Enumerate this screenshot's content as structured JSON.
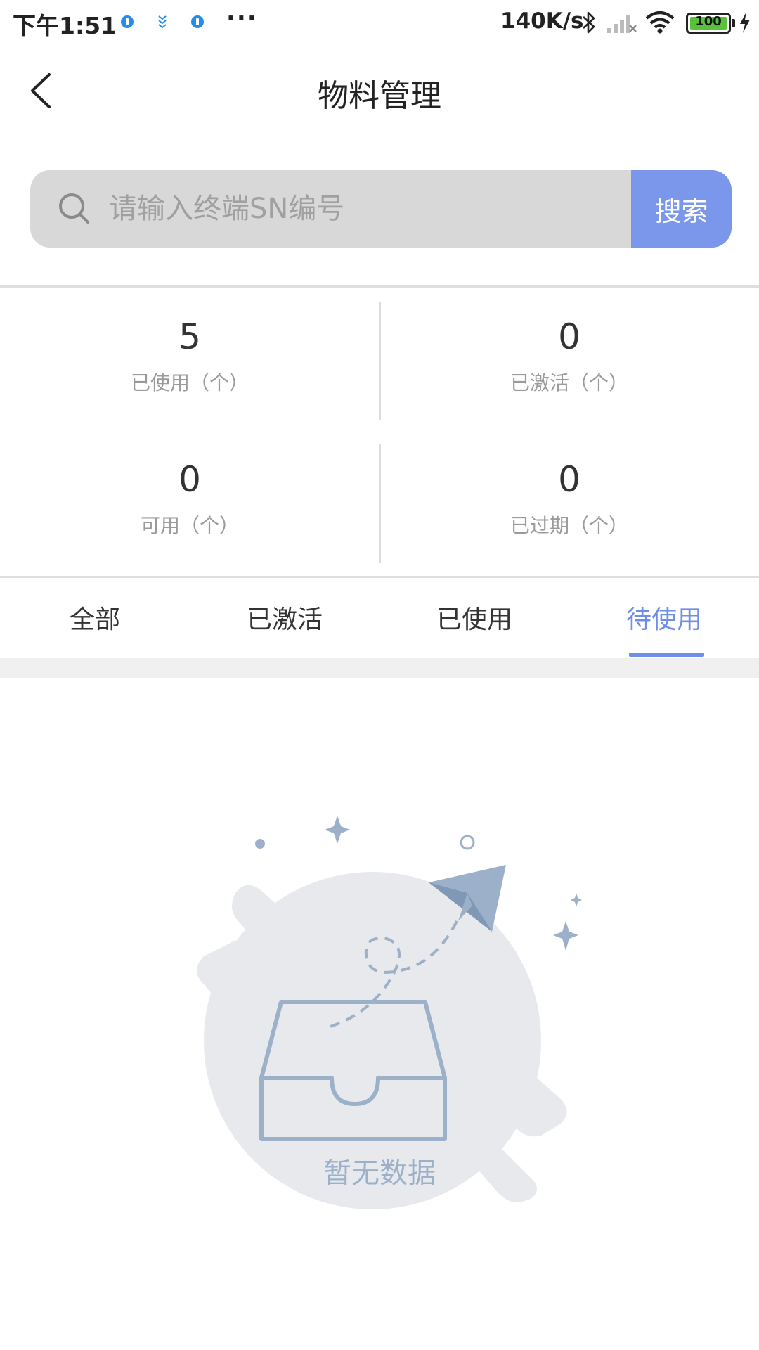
{
  "status_bar": {
    "time": "下午1:51",
    "dots": "···",
    "net_speed": "140K/s",
    "battery": "100"
  },
  "header": {
    "title": "物料管理"
  },
  "search": {
    "placeholder": "请输入终端SN编号",
    "button_label": "搜索"
  },
  "stats": [
    {
      "value": "5",
      "label": "已使用（个）"
    },
    {
      "value": "0",
      "label": "已激活（个）"
    },
    {
      "value": "0",
      "label": "可用（个）"
    },
    {
      "value": "0",
      "label": "已过期（个）"
    }
  ],
  "tabs": [
    {
      "label": "全部"
    },
    {
      "label": "已激活"
    },
    {
      "label": "已使用"
    },
    {
      "label": "待使用"
    }
  ],
  "active_tab": "待使用",
  "empty_state": {
    "text": "暂无数据"
  },
  "colors": {
    "accent": "#7b97eb",
    "search_bg": "#d8d8d8",
    "illustration": "#9cb1c9"
  }
}
